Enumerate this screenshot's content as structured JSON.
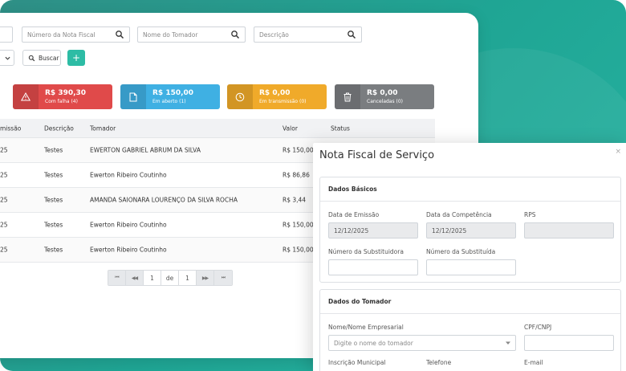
{
  "search": {
    "nota_fiscal_placeholder": "Número da Nota Fiscal",
    "tomador_placeholder": "Nome do Tomador",
    "descricao_placeholder": "Descrição",
    "buscar_label": "Buscar",
    "add_label": "+"
  },
  "cards": [
    {
      "value": "R$ 390,30",
      "label": "Com falha (4)",
      "color": "#e04a4a"
    },
    {
      "value": "R$ 150,00",
      "label": "Em aberto (1)",
      "color": "#3fb0e3"
    },
    {
      "value": "R$ 0,00",
      "label": "Em transmissão (0)",
      "color": "#f0aa2a"
    },
    {
      "value": "R$ 0,00",
      "label": "Canceladas (0)",
      "color": "#7a7d80"
    }
  ],
  "table": {
    "headers": {
      "emissao": "missão",
      "descricao": "Descrição",
      "tomador": "Tomador",
      "valor": "Valor",
      "status": "Status"
    },
    "rows": [
      {
        "emissao": "25",
        "descricao": "Testes",
        "tomador": "EWERTON GABRIEL ABRUM DA SILVA",
        "valor": "R$ 150,00"
      },
      {
        "emissao": "25",
        "descricao": "Testes",
        "tomador": "Ewerton Ribeiro Coutinho",
        "valor": "R$ 86,86"
      },
      {
        "emissao": "25",
        "descricao": "Testes",
        "tomador": "AMANDA SAIONARA LOURENÇO DA SILVA ROCHA",
        "valor": "R$ 3,44"
      },
      {
        "emissao": "25",
        "descricao": "Testes",
        "tomador": "Ewerton Ribeiro Coutinho",
        "valor": "R$ 150,00"
      },
      {
        "emissao": "25",
        "descricao": "Testes",
        "tomador": "Ewerton Ribeiro Coutinho",
        "valor": "R$ 150,00"
      }
    ]
  },
  "pager": {
    "first": "⏮",
    "prev": "◀◀",
    "current": "1",
    "of": "de",
    "total": "1",
    "next": "▶▶",
    "last": "⏭"
  },
  "modal": {
    "title": "Nota Fiscal de Serviço",
    "close": "×",
    "dados_basicos": {
      "title": "Dados Básicos",
      "data_emissao_label": "Data de Emissão",
      "data_emissao_value": "12/12/2025",
      "data_competencia_label": "Data da Competência",
      "data_competencia_value": "12/12/2025",
      "rps_label": "RPS",
      "num_substituidora_label": "Número da Substituidora",
      "num_substituida_label": "Número da Substituída"
    },
    "dados_tomador": {
      "title": "Dados do Tomador",
      "nome_label": "Nome/Nome Empresarial",
      "nome_placeholder": "Digite o nome do tomador",
      "cpf_label": "CPF/CNPJ",
      "inscricao_label": "Inscrição Municipal",
      "telefone_label": "Telefone",
      "email_label": "E-mail"
    }
  }
}
